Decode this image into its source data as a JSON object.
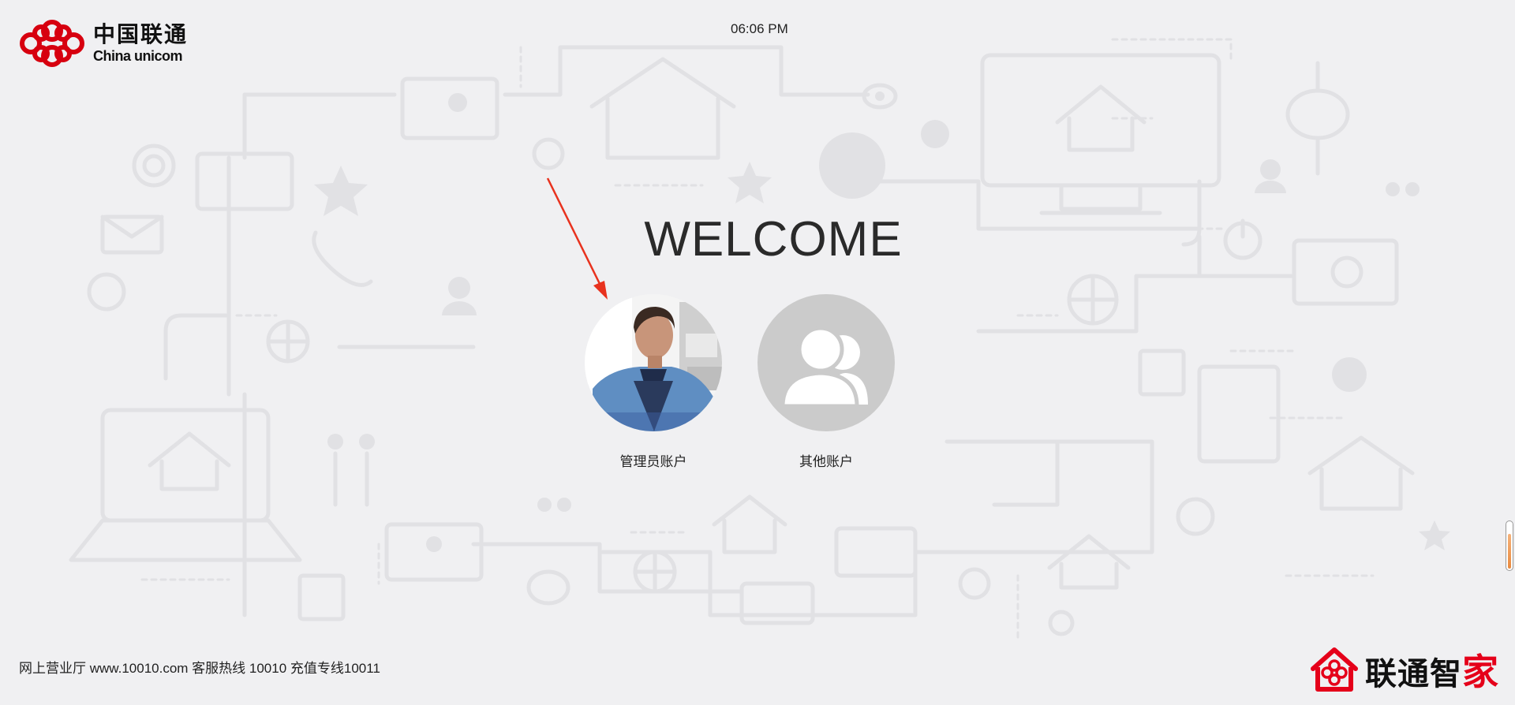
{
  "header": {
    "logo_cn": "中国联通",
    "logo_en": "China unicom",
    "clock": "06:06 PM"
  },
  "main": {
    "welcome": "WELCOME",
    "accounts": [
      {
        "label": "管理员账户",
        "avatar": "admin-photo"
      },
      {
        "label": "其他账户",
        "avatar": "users-icon"
      }
    ]
  },
  "footer": {
    "links_text": "网上营业厅 www.10010.com 客服热线 10010 充值专线10011",
    "brand_part1": "联通智",
    "brand_part2": "家"
  },
  "colors": {
    "background": "#f0f0f2",
    "brand_red": "#e5001a",
    "arrow_red": "#e8321e",
    "avatar_grey": "#cbcbcb"
  }
}
